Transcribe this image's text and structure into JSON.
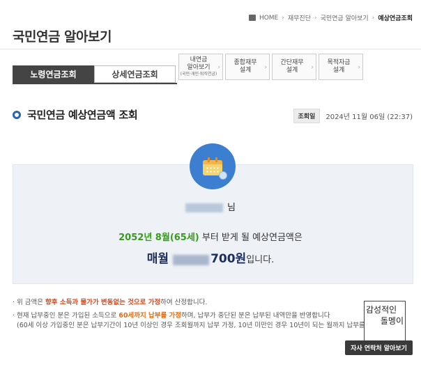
{
  "breadcrumb": {
    "items": [
      "HOME",
      "재무진단",
      "국민연금 알아보기",
      "예상연금조회"
    ]
  },
  "page": {
    "title": "국민연금 알아보기"
  },
  "tabs": [
    {
      "label": "노령연금조회",
      "active": true
    },
    {
      "label": "상세연금조회",
      "active": false
    }
  ],
  "quick_links": [
    {
      "line1": "내연금",
      "line2": "알아보기",
      "sub": "(국민·개인·퇴직연금)"
    },
    {
      "line1": "종합재무",
      "line2": "설계",
      "sub": ""
    },
    {
      "line1": "간단재무",
      "line2": "설계",
      "sub": ""
    },
    {
      "line1": "목적자금",
      "line2": "설계",
      "sub": ""
    }
  ],
  "section": {
    "title": "국민연금 예상연금액 조회",
    "inquiry_label": "조회일",
    "inquiry_date": "2024년 11월 06일 (22:37)"
  },
  "result": {
    "name_suffix": "님",
    "date_highlight": "2052년 8월(65세)",
    "date_rest": " 부터 받게 될 예상연금액은",
    "monthly_label": "매월",
    "amount_suffix": "700원",
    "amount_tail": "입니다."
  },
  "notes": {
    "n1_pre": "위 금액은 ",
    "n1_red": "향후 소득과 물가가 변동없는 것으로 가정",
    "n1_post": "하여 산정합니다.",
    "n2_pre": "현재 납부중인 분은 가입된 소득으로 ",
    "n2_orange": "60세까지 납부를 가정",
    "n2_post": "하며, 납부가 중단된 분은 납부된 내역만을 반영합니다",
    "n3": "(60세 이상 가입중인 분은 납부기간이 10년 이상인 경우 조회월까지 납부 가정, 10년 미만인 경우 10년이 되는 월까지 납부를 가정"
  },
  "watermark": {
    "line1": "감성적인",
    "line2": "돌멩이"
  },
  "contact_button": "자사 연락처 알아보기",
  "colors": {
    "accent_blue": "#2a64b6",
    "badge_blue": "#3c7fd1",
    "green": "#3a9a1e",
    "red": "#d94a1e"
  }
}
